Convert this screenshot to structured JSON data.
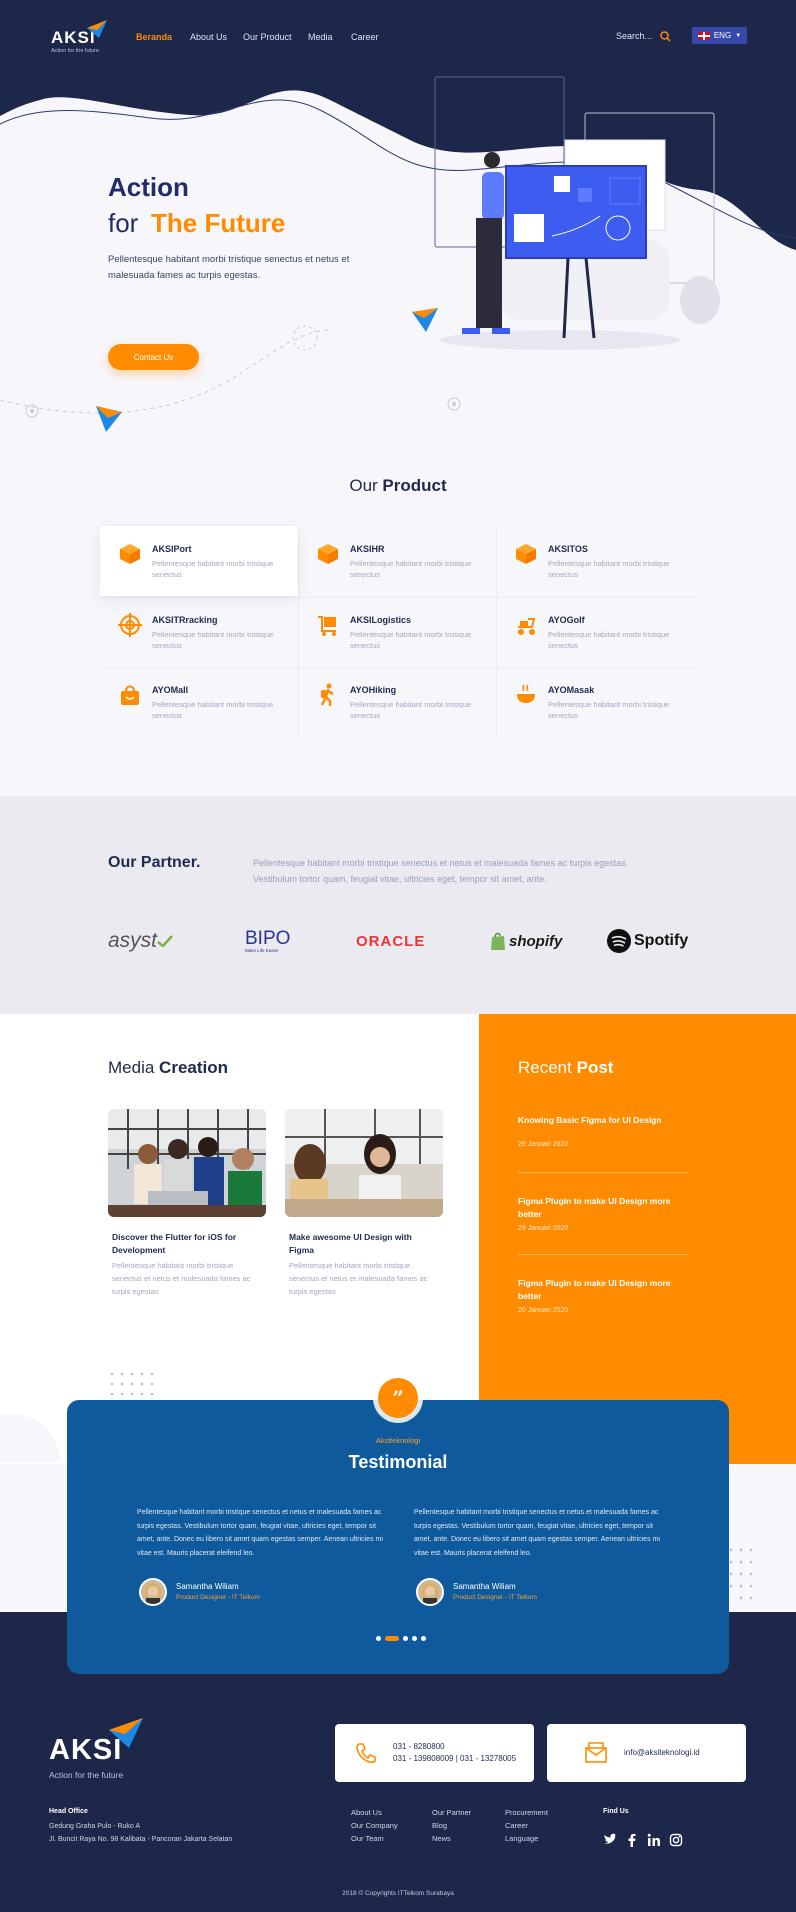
{
  "brand": {
    "name": "AKSI",
    "tagline": "Action for the future"
  },
  "nav": {
    "items": [
      {
        "label": "Beranda",
        "active": true
      },
      {
        "label": "About Us",
        "active": false
      },
      {
        "label": "Our Product",
        "active": false
      },
      {
        "label": "Media",
        "active": false
      },
      {
        "label": "Career",
        "active": false
      }
    ],
    "search_placeholder": "Search...",
    "language": "ENG"
  },
  "hero": {
    "title_line1": "Action",
    "title_line2_prefix": "for",
    "title_line2_highlight": "The Future",
    "description": "Pellentesque habitant morbi tristique senectus et netus et malesuada fames ac turpis egestas.",
    "cta": "Contact Us"
  },
  "products": {
    "title_light": "Our",
    "title_bold": "Product",
    "items": [
      {
        "name": "AKSIPort",
        "desc": "Pellentesque habitant morbi tristique senectus",
        "icon": "box-icon"
      },
      {
        "name": "AKSIHR",
        "desc": "Pellentesque habitant morbi tristique senectus",
        "icon": "box-icon"
      },
      {
        "name": "AKSITOS",
        "desc": "Pellentesque habitant morbi tristique senectus",
        "icon": "box-icon"
      },
      {
        "name": "AKSITRracking",
        "desc": "Pellentesque habitant morbi tristique senectus",
        "icon": "target-icon"
      },
      {
        "name": "AKSILogistics",
        "desc": "Pellentesque habitant morbi tristique senectus",
        "icon": "cart-icon"
      },
      {
        "name": "AYOGolf",
        "desc": "Pellentesque habitant morbi tristique senectus",
        "icon": "golf-cart-icon"
      },
      {
        "name": "AYOMall",
        "desc": "Pellentesque habitant morbi tristique senectus",
        "icon": "shopping-bag-icon"
      },
      {
        "name": "AYOHiking",
        "desc": "Pellentesque habitant morbi tristique senectus",
        "icon": "hiking-icon"
      },
      {
        "name": "AYOMasak",
        "desc": "Pellentesque habitant morbi tristique senectus",
        "icon": "cooking-icon"
      }
    ]
  },
  "partners": {
    "title": "Our Partner.",
    "description": "Pellentesque habitant morbi tristique senectus et netus et malesuada fames ac turpis egestas. Vestibulum tortor quam, feugiat vitae, ultricies eget, tempor sit amet, ante.",
    "logos": [
      {
        "name": "asyst"
      },
      {
        "name": "BIPO",
        "sub": "Make Life Easier"
      },
      {
        "name": "ORACLE"
      },
      {
        "name": "shopify"
      },
      {
        "name": "Spotify"
      }
    ]
  },
  "media": {
    "title_light": "Media",
    "title_bold": "Creation",
    "cards": [
      {
        "title": "Discover the Flutter for iOS for Development",
        "desc": "Pellentesque habitant morbi tristique senectus et netus et malesuada fames ac turpis egestas"
      },
      {
        "title": "Make awesome UI Design with Figma",
        "desc": "Pellentesque habitant morbi tristique senectus et netus et malesuada fames ac turpis egestas"
      }
    ]
  },
  "recent": {
    "title_light": "Recent",
    "title_bold": "Post",
    "posts": [
      {
        "title": "Knowing Basic Figma for UI Design",
        "date": "29 Januari 2020"
      },
      {
        "title": "Figma Plugin to make UI Design more better",
        "date": "29 Januari 2020"
      },
      {
        "title": "Figma Plugin to make UI Design more better",
        "date": "20 Januari 2020"
      }
    ]
  },
  "testimonial": {
    "kicker": "Aksiteknologi",
    "title": "Testimonial",
    "items": [
      {
        "text": "Pellentesque habitant morbi tristique senectus et netus et malesuada fames ac turpis egestas. Vestibulum tortor quam, feugiat vitae, ultricies eget, tempor sit amet, ante. Donec eu libero sit amet quam egestas semper. Aenean ultricies mi vitae est. Mauris placerat eleifend leo.",
        "name": "Samantha Wiliam",
        "role": "Product Designer - IT Telkom"
      },
      {
        "text": "Pellentesque habitant morbi tristique senectus et netus et malesuada fames ac turpis egestas. Vestibulum tortor quam, feugiat vitae, ultricies eget, tempor sit amet, ante. Donec eu libero sit amet quam egestas semper. Aenean ultricies mi vitae est. Mauris placerat eleifend leo.",
        "name": "Samantha Wiliam",
        "role": "Product Designer - IT Telkom"
      }
    ],
    "pagination": {
      "total": 5,
      "active": 2
    }
  },
  "footer": {
    "phone_line1": "031 - 8280800",
    "phone_line2": "031 - 139808009 | 031 - 13278005",
    "email": "info@aksiteknologi.id",
    "office_head": "Head Office",
    "office_line1": "Gedung Graha Pulo - Ruko A",
    "office_line2": "Jl. Buncit Raya No. 98 Kalibata - Pancoran Jakarta Selatan",
    "col1": [
      "About Us",
      "Our Company",
      "Our Team"
    ],
    "col2": [
      "Our Partner",
      "Blog",
      "News"
    ],
    "col3": [
      "Procurement",
      "Career",
      "Language"
    ],
    "find_us": "Find Us",
    "social": [
      "twitter-icon",
      "facebook-icon",
      "linkedin-icon",
      "instagram-icon"
    ],
    "copyright": "2018 © Copyrights ITTelkom Surabaya"
  },
  "colors": {
    "navy": "#1d274a",
    "orange": "#ff8c00",
    "blue": "#0e5a9c"
  }
}
